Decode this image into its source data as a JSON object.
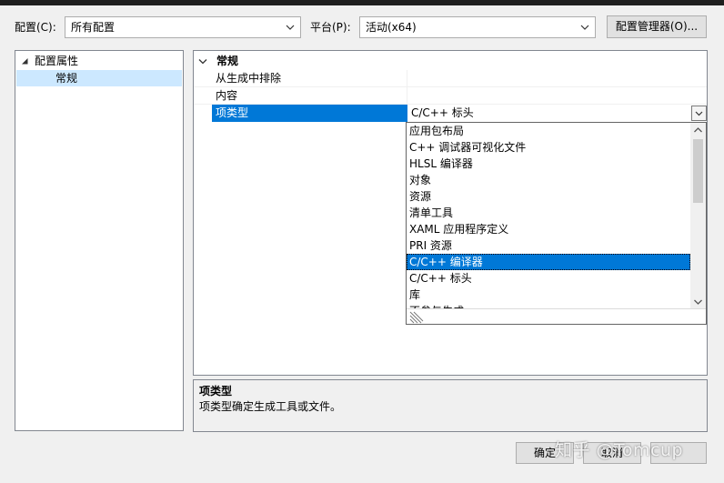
{
  "toolbar": {
    "config_label": "配置(C):",
    "config_value": "所有配置",
    "platform_label": "平台(P):",
    "platform_value": "活动(x64)",
    "config_manager_label": "配置管理器(O)..."
  },
  "tree": {
    "root_label": "配置属性",
    "child_label": "常规"
  },
  "grid": {
    "category": "常规",
    "rows": [
      {
        "name": "从生成中排除",
        "value": ""
      },
      {
        "name": "内容",
        "value": ""
      },
      {
        "name": "项类型",
        "value": "C/C++ 标头"
      }
    ]
  },
  "dropdown": {
    "items": [
      "应用包布局",
      "C++ 调试器可视化文件",
      "HLSL 编译器",
      "对象",
      "资源",
      "清单工具",
      "XAML 应用程序定义",
      "PRI 资源",
      "C/C++ 编译器",
      "C/C++ 标头",
      "库",
      "不参与生成"
    ],
    "selected": "C/C++ 编译器"
  },
  "description": {
    "title": "项类型",
    "text": "项类型确定生成工具或文件。"
  },
  "buttons": {
    "ok_label": "确定",
    "cancel_label": "取消"
  },
  "watermark": "知乎 @Tomcup",
  "colors": {
    "selection": "#0078d7",
    "border": "#828790",
    "background": "#f0f0f0"
  }
}
